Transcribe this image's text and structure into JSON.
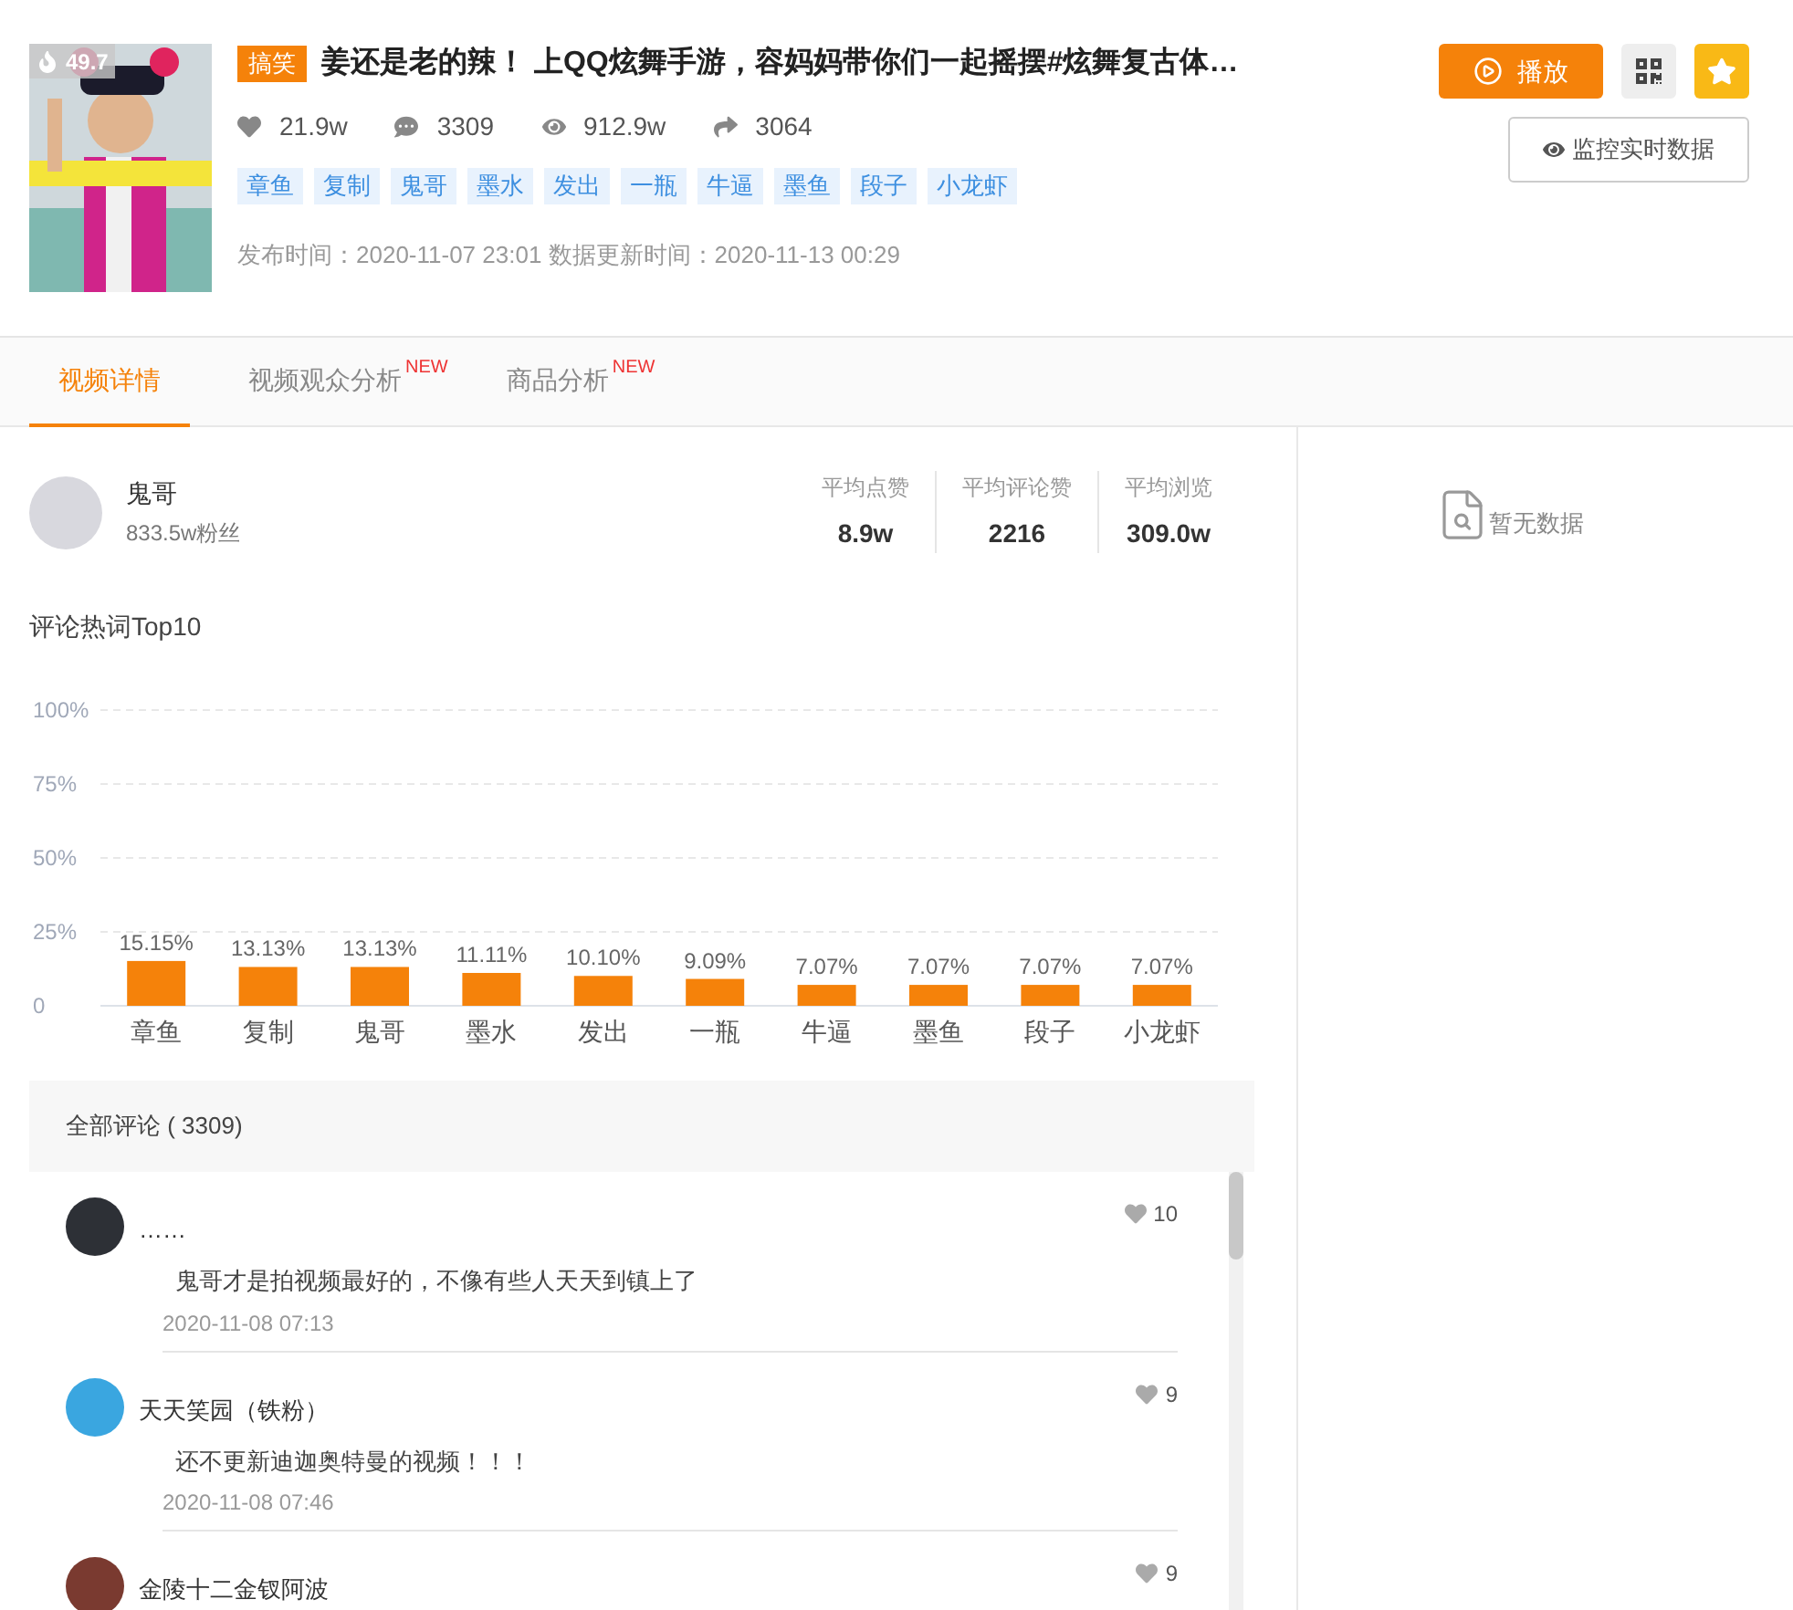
{
  "video": {
    "heat": "49.7",
    "category": "搞笑",
    "title": "姜还是老的辣！ 上QQ炫舞手游，容妈妈带你们一起摇摆#炫舞复古体…",
    "stats": [
      {
        "kind": "likes",
        "value": "21.9w"
      },
      {
        "kind": "comments",
        "value": "3309"
      },
      {
        "kind": "views",
        "value": "912.9w"
      },
      {
        "kind": "shares",
        "value": "3064"
      }
    ],
    "tags": [
      "章鱼",
      "复制",
      "鬼哥",
      "墨水",
      "发出",
      "一瓶",
      "牛逼",
      "墨鱼",
      "段子",
      "小龙虾"
    ],
    "times": "发布时间：2020-11-07 23:01 数据更新时间：2020-11-13 00:29",
    "play_button": "播放",
    "monitor_button": "监控实时数据"
  },
  "tabs": [
    {
      "label": "视频详情",
      "selected": true
    },
    {
      "label": "视频观众分析",
      "selected": false,
      "badge": "NEW"
    },
    {
      "label": "商品分析",
      "selected": false,
      "badge": "NEW"
    }
  ],
  "author": {
    "name": "鬼哥",
    "fans": "833.5w粉丝",
    "metrics": [
      {
        "label": "平均点赞",
        "value": "8.9w"
      },
      {
        "label": "平均评论赞",
        "value": "2216"
      },
      {
        "label": "平均浏览",
        "value": "309.0w"
      }
    ]
  },
  "hot_words": {
    "title": "评论热词Top10",
    "chart_data": {
      "type": "bar",
      "categories": [
        "章鱼",
        "复制",
        "鬼哥",
        "墨水",
        "发出",
        "一瓶",
        "牛逼",
        "墨鱼",
        "段子",
        "小龙虾"
      ],
      "grid": true,
      "series": [
        {
          "color": "#f5820a",
          "values": [
            15.15,
            13.13,
            13.13,
            11.11,
            10.1,
            9.09,
            7.07,
            7.07,
            7.07,
            7.07
          ]
        }
      ],
      "ylim": [
        0,
        100
      ],
      "yticks": [
        {
          "value": 0,
          "label": "0"
        },
        {
          "value": 25,
          "label": "25%"
        },
        {
          "value": 50,
          "label": "50%"
        },
        {
          "value": 75,
          "label": "75%"
        },
        {
          "value": 100,
          "label": "100%"
        }
      ],
      "value_labels": [
        "15.15%",
        "13.13%",
        "13.13%",
        "11.11%",
        "10.10%",
        "9.09%",
        "7.07%",
        "7.07%",
        "7.07%",
        "7.07%"
      ]
    }
  },
  "comments": {
    "title": "全部评论 ( 3309)",
    "items": [
      {
        "name": "……",
        "text": "鬼哥才是拍视频最好的，不像有些人天天到镇上了",
        "time": "2020-11-08 07:13",
        "likes": "10"
      },
      {
        "name": "天天笑园（铁粉）",
        "text": "还不更新迪迦奥特曼的视频！！！",
        "time": "2020-11-08 07:46",
        "likes": "9"
      },
      {
        "name": "金陵十二金钗阿波",
        "likes": "9"
      }
    ]
  },
  "side_panel": {
    "empty_text": "暂无数据"
  }
}
